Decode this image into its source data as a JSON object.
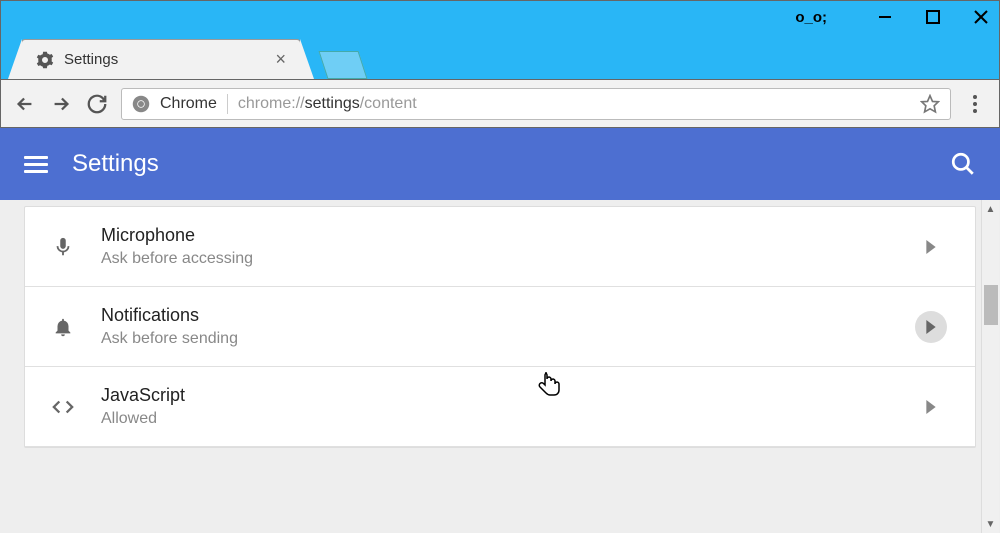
{
  "window": {
    "emoji": "o_o;"
  },
  "tab": {
    "title": "Settings"
  },
  "omnibox": {
    "chrome_label": "Chrome",
    "url_prefix": "chrome://",
    "url_bold": "settings",
    "url_suffix": "/content"
  },
  "appbar": {
    "title": "Settings"
  },
  "settings_items": [
    {
      "title": "Microphone",
      "subtitle": "Ask before accessing",
      "icon": "microphone"
    },
    {
      "title": "Notifications",
      "subtitle": "Ask before sending",
      "icon": "bell"
    },
    {
      "title": "JavaScript",
      "subtitle": "Allowed",
      "icon": "code"
    }
  ]
}
